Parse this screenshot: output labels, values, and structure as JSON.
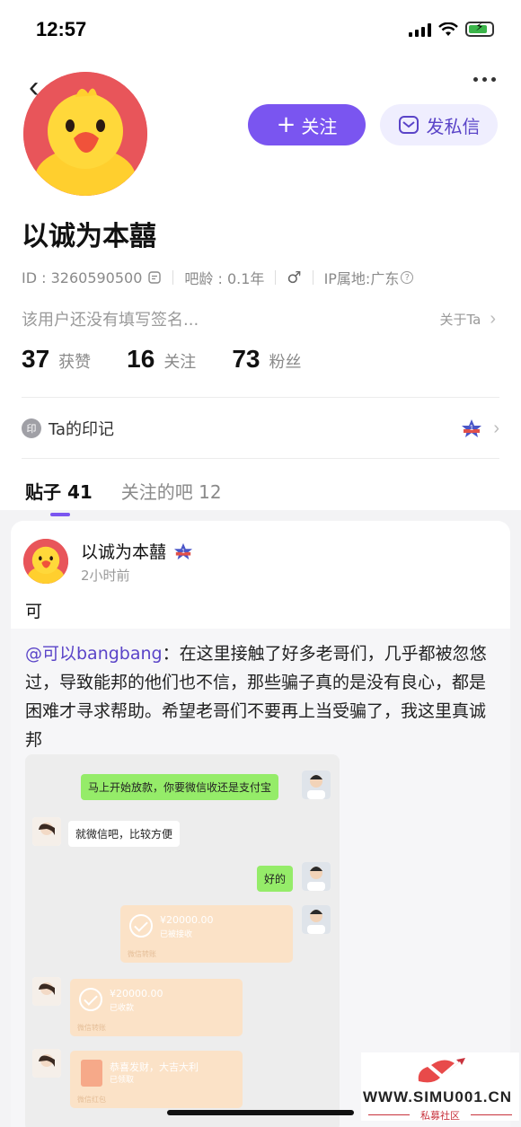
{
  "status_bar": {
    "time": "12:57"
  },
  "header": {
    "back": "‹"
  },
  "profile": {
    "follow_label": "关注",
    "message_label": "发私信",
    "username": "以诚为本囍",
    "id_text": "ID : 3260590500",
    "age_text": "吧龄 : 0.1年",
    "gender_symbol": "♂",
    "ip_text": "IP属地:广东",
    "signature": "该用户还没有填写签名...",
    "about_label": "关于Ta",
    "stats": [
      {
        "num": "37",
        "label": "获赞"
      },
      {
        "num": "16",
        "label": "关注"
      },
      {
        "num": "73",
        "label": "粉丝"
      }
    ],
    "badge_icon": "印",
    "badge_label": "Ta的印记",
    "badge_level": "1"
  },
  "tabs": [
    {
      "label": "贴子 41"
    },
    {
      "label": "关注的吧 12"
    }
  ],
  "post": {
    "author": "以诚为本囍",
    "level": "1",
    "time": "2小时前",
    "text": "可",
    "quote_mention": "@可以bangbang",
    "quote_body": "：在这里接触了好多老哥们，几乎都被忽悠过，导致能邦的他们也不信，那些骗子真的是没有良心，都是困难才寻求帮助。希望老哥们不要再上当受骗了，我这里真诚邦"
  },
  "chat": {
    "msg1": "马上开始放款，你要微信收还是支付宝",
    "msg2": "就微信吧，比较方便",
    "msg3": "好的",
    "transfer1_amount": "¥20000.00",
    "transfer1_status": "已被接收",
    "transfer1_foot": "微信转账",
    "transfer2_amount": "¥20000.00",
    "transfer2_status": "已收款",
    "transfer2_foot": "微信转账",
    "redpacket_title": "恭喜发财，大吉大利",
    "redpacket_status": "已领取",
    "redpacket_foot": "微信红包"
  },
  "watermark": {
    "url": "WWW.SIMU001.CN",
    "sub": "私募社区"
  },
  "colors": {
    "accent": "#7a55f0",
    "avatar_bg": "#e8555a",
    "duck": "#ffcf2e"
  }
}
